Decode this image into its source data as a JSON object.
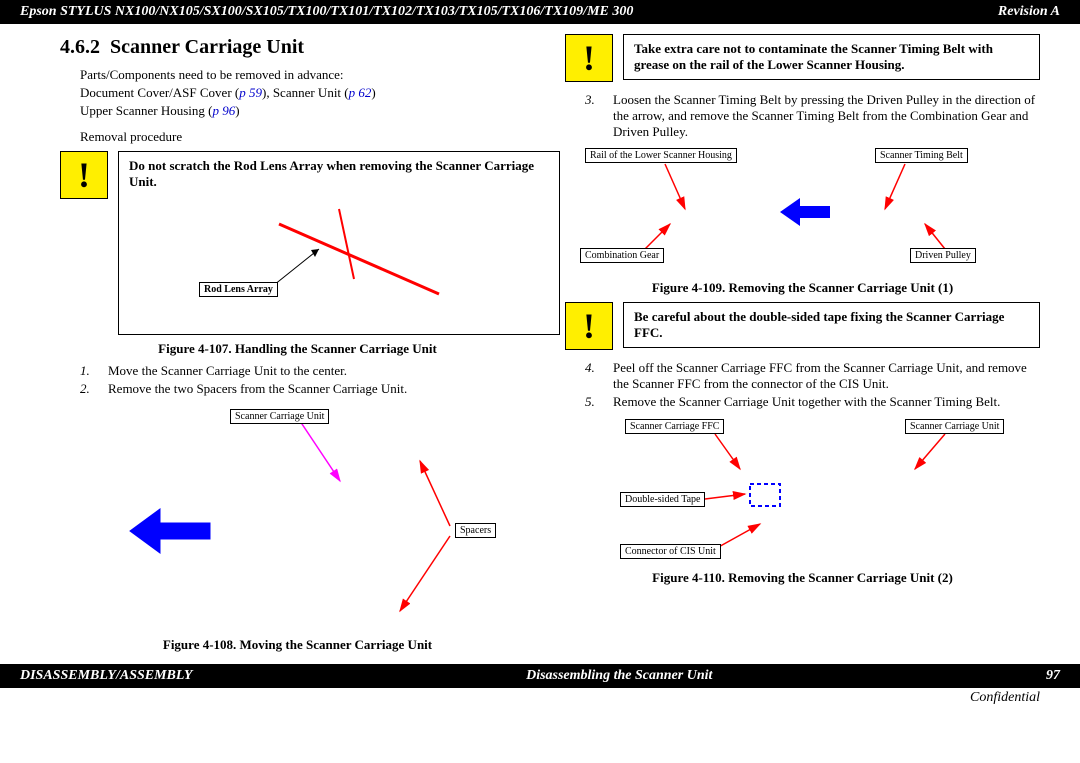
{
  "header": {
    "title": "Epson STYLUS NX100/NX105/SX100/SX105/TX100/TX101/TX102/TX103/TX105/TX106/TX109/ME 300",
    "revision": "Revision A"
  },
  "section": {
    "number": "4.6.2",
    "title": "Scanner Carriage Unit"
  },
  "intro": {
    "parts_line": "Parts/Components need to be removed in advance:",
    "doc_cover": "Document Cover/ASF Cover (",
    "p59": "p 59",
    "scanner_unit": "), Scanner Unit (",
    "p62": "p 62",
    "close1": ")",
    "upper_scanner": "Upper Scanner Housing (",
    "p96": "p 96",
    "close2": ")",
    "removal": "Removal procedure"
  },
  "caution1": "Do not scratch the Rod Lens Array when removing the Scanner Carriage Unit.",
  "labels": {
    "rod_lens": "Rod Lens Array",
    "scanner_carriage": "Scanner Carriage Unit",
    "spacers": "Spacers",
    "rail_lower": "Rail of the Lower Scanner Housing",
    "scanner_timing_belt": "Scanner Timing Belt",
    "combination_gear": "Combination Gear",
    "driven_pulley": "Driven Pulley",
    "scanner_carriage_ffc": "Scanner Carriage FFC",
    "double_sided_tape": "Double-sided Tape",
    "connector_cis": "Connector of CIS Unit"
  },
  "figures": {
    "f107": "Figure 4-107.  Handling the Scanner Carriage Unit",
    "f108": "Figure 4-108.  Moving the Scanner Carriage Unit",
    "f109": "Figure 4-109.  Removing the Scanner Carriage Unit (1)",
    "f110": "Figure 4-110.  Removing the Scanner Carriage Unit (2)"
  },
  "steps": {
    "s1": "Move the Scanner Carriage Unit to the center.",
    "s2": "Remove the two Spacers from the Scanner Carriage Unit.",
    "s3": "Loosen the Scanner Timing Belt by pressing the Driven Pulley in the direction of the arrow, and remove the Scanner Timing Belt from the Combination Gear and Driven Pulley.",
    "s4": "Peel off the Scanner Carriage FFC from the Scanner Carriage Unit, and remove the Scanner FFC from the connector of the CIS Unit.",
    "s5": "Remove the Scanner Carriage Unit together with the Scanner Timing Belt."
  },
  "caution2": "Take extra care not to contaminate the Scanner Timing Belt with grease on the rail of the Lower Scanner Housing.",
  "caution3": "Be careful about the double-sided tape fixing the Scanner Carriage FFC.",
  "footer": {
    "left": "DISASSEMBLY/ASSEMBLY",
    "center": "Disassembling the Scanner Unit",
    "right": "97",
    "confidential": "Confidential"
  }
}
